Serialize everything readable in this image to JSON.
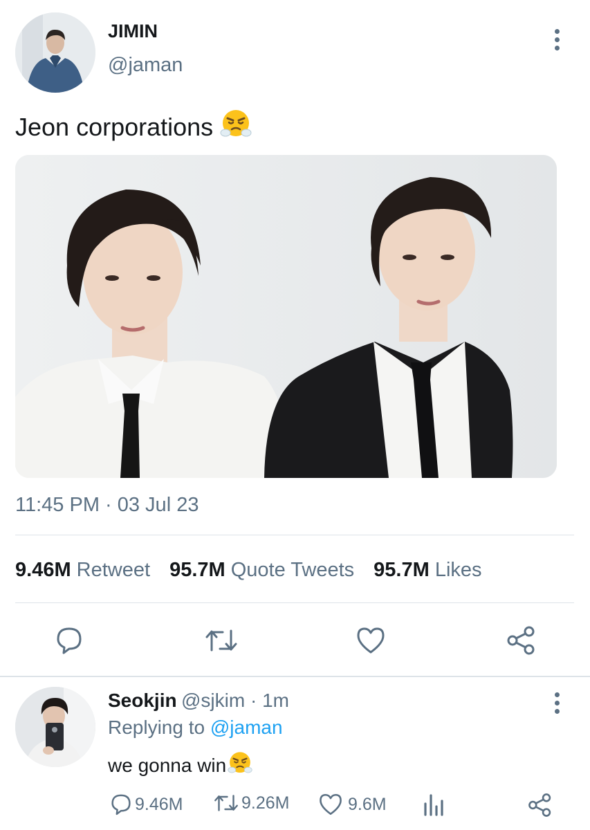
{
  "tweet": {
    "author_name": "JIMIN",
    "author_handle": "@jaman",
    "text": "Jeon corporations",
    "text_emoji": "steam-from-nose-emoji",
    "timestamp": "11:45 PM · 03 Jul 23",
    "stats": {
      "retweets_count": "9.46M",
      "retweets_label": "Retweet",
      "quotes_count": "95.7M",
      "quotes_label": "Quote Tweets",
      "likes_count": "95.7M",
      "likes_label": "Likes"
    },
    "actions": [
      "reply-icon",
      "retweet-icon",
      "like-icon",
      "share-icon"
    ]
  },
  "reply": {
    "author_name": "Seokjin",
    "author_handle": "@sjkim",
    "time": "1m",
    "replying_prefix": "Replying to",
    "replying_to": "@jaman",
    "text": "we gonna win",
    "text_emoji": "steam-from-nose-emoji",
    "reply_count": "9.46M",
    "retweet_count": "9.26M",
    "like_count": "9.6M"
  },
  "colors": {
    "accent": "#1da1f2",
    "muted_text": "#5b7083",
    "divider": "#dde3e8"
  }
}
